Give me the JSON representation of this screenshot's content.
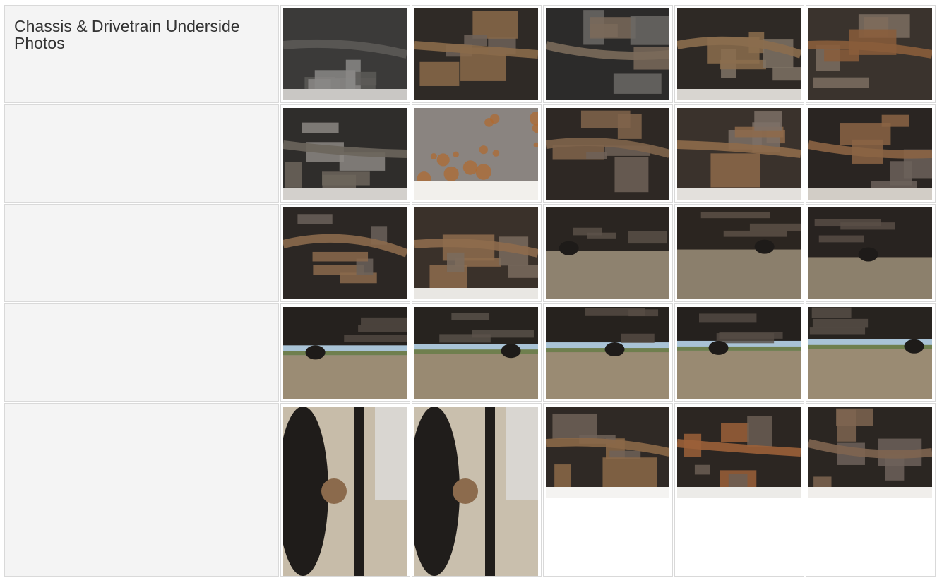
{
  "section": {
    "title": "Chassis & Drivetrain Underside Photos"
  },
  "photos": [
    {
      "name": "photo-transmission-underside",
      "palette": [
        "#8a8886",
        "#3b3a39",
        "#c9c7c4",
        "#5c5a57"
      ],
      "kind": "undercarriage-bright"
    },
    {
      "name": "photo-exhaust-pipe-frame",
      "palette": [
        "#6d6259",
        "#2f2a26",
        "#b4a89a",
        "#8a6a4a"
      ],
      "kind": "undercarriage-rust"
    },
    {
      "name": "photo-frame-rail-crossmember",
      "palette": [
        "#6b6865",
        "#2c2b2a",
        "#9c9996",
        "#7a6a5a"
      ],
      "kind": "undercarriage-dark"
    },
    {
      "name": "photo-oil-pan-exhaust",
      "palette": [
        "#7e7265",
        "#2e2925",
        "#d8d5d0",
        "#8b6d4e"
      ],
      "kind": "undercarriage-bright"
    },
    {
      "name": "photo-transfer-case",
      "palette": [
        "#7c6e62",
        "#3a332d",
        "#a59988",
        "#8a5d3b"
      ],
      "kind": "undercarriage-rust"
    },
    {
      "name": "photo-engine-bellhousing",
      "palette": [
        "#8b8783",
        "#2f2d2b",
        "#d3d0cc",
        "#6c655c"
      ],
      "kind": "undercarriage-bright"
    },
    {
      "name": "photo-rusty-skid-plate",
      "palette": [
        "#8a8480",
        "#b06a2e",
        "#f2f0ec",
        "#5d4e44"
      ],
      "kind": "plate"
    },
    {
      "name": "photo-transmission-lines",
      "palette": [
        "#6e6258",
        "#2e2824",
        "#c6c0b8",
        "#80644b"
      ],
      "kind": "undercarriage-rust"
    },
    {
      "name": "photo-driveshaft-boot",
      "palette": [
        "#7d7066",
        "#3a322c",
        "#e3e0dc",
        "#8e6a4a"
      ],
      "kind": "undercarriage-bright"
    },
    {
      "name": "photo-differential-wiring",
      "palette": [
        "#6c625a",
        "#2a2522",
        "#d2cdc6",
        "#8b6444"
      ],
      "kind": "undercarriage-bright"
    },
    {
      "name": "photo-fuel-tank-driveshaft",
      "palette": [
        "#6b625b",
        "#2c2724",
        "#a8a29b",
        "#8b6a4c"
      ],
      "kind": "undercarriage-dark"
    },
    {
      "name": "photo-driveshaft-u-joint",
      "palette": [
        "#7a6b5e",
        "#3a312a",
        "#e9e7e3",
        "#8e6c4d"
      ],
      "kind": "undercarriage-bright"
    },
    {
      "name": "photo-muffler-ground",
      "palette": [
        "#5d524a",
        "#2a2521",
        "#b9b0a2",
        "#8e826f"
      ],
      "kind": "ground"
    },
    {
      "name": "photo-rear-frame-ground",
      "palette": [
        "#5f5349",
        "#2b2520",
        "#bcb3a5",
        "#8b7f6c"
      ],
      "kind": "ground"
    },
    {
      "name": "photo-axle-housing-ground",
      "palette": [
        "#5a4f47",
        "#282320",
        "#b7ae9f",
        "#8c806c"
      ],
      "kind": "ground"
    },
    {
      "name": "photo-underbody-left-side",
      "palette": [
        "#544b44",
        "#25211e",
        "#b8b0a1",
        "#9b8c74"
      ],
      "kind": "ground-sky"
    },
    {
      "name": "photo-front-suspension-ground",
      "palette": [
        "#5b524b",
        "#27231f",
        "#b5ac9d",
        "#998a72"
      ],
      "kind": "ground-sky"
    },
    {
      "name": "photo-frame-rails-horizon",
      "palette": [
        "#574d45",
        "#26221e",
        "#b9b1a2",
        "#9a8b73"
      ],
      "kind": "ground-sky"
    },
    {
      "name": "photo-rear-axle-horizon",
      "palette": [
        "#554c45",
        "#25211e",
        "#bab2a3",
        "#998a72"
      ],
      "kind": "ground-sky"
    },
    {
      "name": "photo-right-side-underbody",
      "palette": [
        "#5a5049",
        "#27231f",
        "#b7af9f",
        "#9a8b73"
      ],
      "kind": "ground-sky"
    },
    {
      "name": "photo-front-wheel-hub-left",
      "palette": [
        "#4a4440",
        "#1f1c1a",
        "#c7bca9",
        "#8b6a4c"
      ],
      "kind": "wheel"
    },
    {
      "name": "photo-front-wheel-hub-right",
      "palette": [
        "#4b4541",
        "#201d1b",
        "#c9bfad",
        "#8c6b4d"
      ],
      "kind": "wheel"
    },
    {
      "name": "photo-leaf-spring-hanger",
      "palette": [
        "#6e6258",
        "#2f2925",
        "#f4f3f1",
        "#8b6848"
      ],
      "kind": "undercarriage-bright"
    },
    {
      "name": "photo-rear-leaf-spring",
      "palette": [
        "#6b5e53",
        "#2c2622",
        "#ecebe8",
        "#9b6038"
      ],
      "kind": "undercarriage-bright"
    },
    {
      "name": "photo-rear-differential",
      "palette": [
        "#6d625a",
        "#2b2622",
        "#f0eeeb",
        "#7e6550"
      ],
      "kind": "undercarriage-bright"
    }
  ]
}
